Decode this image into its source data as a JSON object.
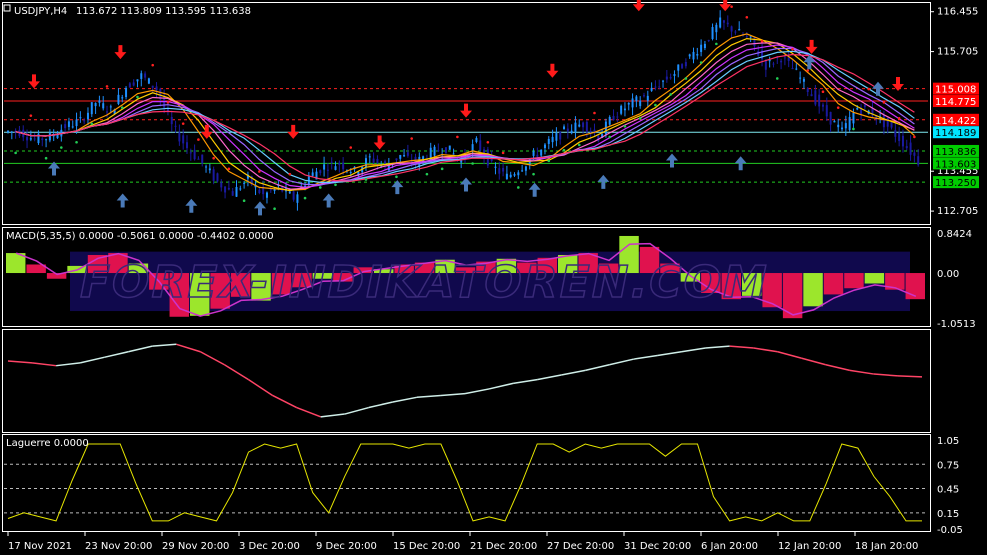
{
  "header": {
    "symbol": "USDJPY,H4",
    "ohlc": "113.672 113.809 113.595 113.638"
  },
  "price_axis": {
    "labels": [
      "116.455",
      "115.705",
      "113.455",
      "112.705"
    ]
  },
  "price_tags": [
    {
      "text": "115.008",
      "bg": "#ff0000",
      "fg": "#ffffff",
      "line": "#ff2020",
      "dash": true,
      "price": 115.008
    },
    {
      "text": "114.775",
      "bg": "#ff0000",
      "fg": "#ffffff",
      "line": "#ff2020",
      "dash": false,
      "price": 114.775
    },
    {
      "text": "114.422",
      "bg": "#ff0000",
      "fg": "#ffffff",
      "line": "#ff2020",
      "dash": true,
      "price": 114.422
    },
    {
      "text": "114.189",
      "bg": "#00e5ff",
      "fg": "#000000",
      "line": "#7fe9ef",
      "dash": false,
      "price": 114.189
    },
    {
      "text": "113.836",
      "bg": "#00cc00",
      "fg": "#000000",
      "line": "#22cc22",
      "dash": true,
      "price": 113.836
    },
    {
      "text": "113.603",
      "bg": "#00cc00",
      "fg": "#000000",
      "line": "#22cc22",
      "dash": false,
      "price": 113.603
    },
    {
      "text": "113.250",
      "bg": "#00cc00",
      "fg": "#000000",
      "line": "#22cc22",
      "dash": true,
      "price": 113.25
    }
  ],
  "macd": {
    "label": "MACD(5,35,5) 0.0000 -0.5061 0.0000 -0.4402 0.0000",
    "axis_labels": [
      "0.8424",
      "0.00",
      "-1.0513"
    ]
  },
  "watermark": "FOREX-INDIKATOREN.COM",
  "laguerre": {
    "label": "Laguerre 0.0000",
    "axis_labels": [
      "1.05",
      "0.75",
      "0.45",
      "0.15",
      "-0.05"
    ],
    "level_lines": [
      0.75,
      0.45,
      0.15
    ]
  },
  "time_axis": {
    "labels": [
      "17 Nov 2021",
      "23 Nov 20:00",
      "29 Nov 20:00",
      "3 Dec 20:00",
      "9 Dec 20:00",
      "15 Dec 20:00",
      "21 Dec 20:00",
      "27 Dec 20:00",
      "31 Dec 20:00",
      "6 Jan 20:00",
      "12 Jan 20:00",
      "18 Jan 20:00"
    ]
  },
  "colors": {
    "bull_candle": "#1e90ff",
    "bear_candle": "#1a1aa0",
    "sell_arrow": "#ff1a1a",
    "buy_arrow": "#4a7ab8",
    "trail_red": "#ff2020",
    "trail_green": "#22cc55",
    "macd_up": "#9ce62c",
    "macd_down": "#e0124e",
    "macd_signal": "#cc33cc",
    "osc_up": "#cfeee8",
    "osc_down": "#ff4466",
    "laguerre": "#e6e600"
  },
  "chart_data": {
    "type": "candlestick",
    "title": "USDJPY,H4",
    "close_series": [
      114.2,
      114.05,
      114.1,
      114.3,
      114.4,
      114.75,
      114.6,
      115.05,
      115.25,
      115.0,
      114.3,
      113.9,
      113.6,
      113.25,
      113.05,
      113.3,
      113.0,
      113.15,
      112.95,
      113.35,
      113.55,
      113.6,
      113.45,
      113.7,
      113.55,
      113.75,
      113.62,
      113.8,
      113.9,
      113.65,
      114.0,
      113.55,
      113.35,
      113.55,
      113.8,
      114.05,
      114.25,
      114.35,
      114.1,
      114.5,
      114.7,
      114.85,
      115.1,
      115.3,
      115.6,
      115.9,
      116.25,
      116.1,
      115.9,
      115.45,
      115.6,
      115.3,
      114.9,
      114.5,
      114.2,
      114.65,
      114.55,
      114.3,
      114.0,
      113.65
    ],
    "ylim": [
      112.5,
      116.6
    ],
    "sell_signals": [
      114.9,
      115.45,
      113.95,
      113.95,
      113.75,
      114.35,
      115.1,
      116.35,
      116.35,
      115.55,
      114.85
    ],
    "buy_signals": [
      113.75,
      113.15,
      113.05,
      113.0,
      113.15,
      113.4,
      113.45,
      113.35,
      113.5,
      113.9,
      113.85,
      115.75,
      115.25
    ],
    "macd_hist": [
      0.42,
      0.18,
      -0.12,
      0.15,
      0.38,
      0.42,
      0.2,
      -0.35,
      -0.92,
      -0.9,
      -0.75,
      -0.5,
      -0.58,
      -0.45,
      -0.3,
      -0.12,
      -0.18,
      0.12,
      0.08,
      0.18,
      0.22,
      0.28,
      0.12,
      0.24,
      0.3,
      0.22,
      0.32,
      0.38,
      0.42,
      0.2,
      0.78,
      0.55,
      0.2,
      -0.18,
      -0.42,
      -0.55,
      -0.48,
      -0.72,
      -0.95,
      -0.7,
      -0.45,
      -0.32,
      -0.22,
      -0.35,
      -0.55
    ],
    "osc_line": [
      0.32,
      0.3,
      0.27,
      0.3,
      0.36,
      0.42,
      0.48,
      0.5,
      0.42,
      0.28,
      0.12,
      -0.05,
      -0.18,
      -0.28,
      -0.25,
      -0.18,
      -0.12,
      -0.07,
      -0.05,
      -0.03,
      0.02,
      0.08,
      0.12,
      0.17,
      0.22,
      0.28,
      0.34,
      0.38,
      0.42,
      0.46,
      0.48,
      0.46,
      0.42,
      0.35,
      0.28,
      0.22,
      0.18,
      0.16,
      0.15
    ],
    "laguerre_values": [
      0.08,
      0.15,
      0.1,
      0.05,
      0.55,
      1.0,
      1.0,
      1.0,
      0.5,
      0.05,
      0.05,
      0.15,
      0.1,
      0.05,
      0.4,
      0.9,
      1.0,
      0.95,
      1.0,
      0.4,
      0.15,
      0.6,
      1.0,
      1.0,
      1.0,
      0.95,
      1.0,
      1.0,
      0.55,
      0.05,
      0.1,
      0.05,
      0.5,
      1.0,
      1.0,
      0.9,
      1.0,
      0.95,
      1.0,
      1.0,
      1.0,
      0.85,
      1.0,
      1.0,
      0.35,
      0.05,
      0.1,
      0.05,
      0.15,
      0.05,
      0.05,
      0.5,
      1.0,
      0.95,
      0.6,
      0.35,
      0.05,
      0.05
    ]
  }
}
